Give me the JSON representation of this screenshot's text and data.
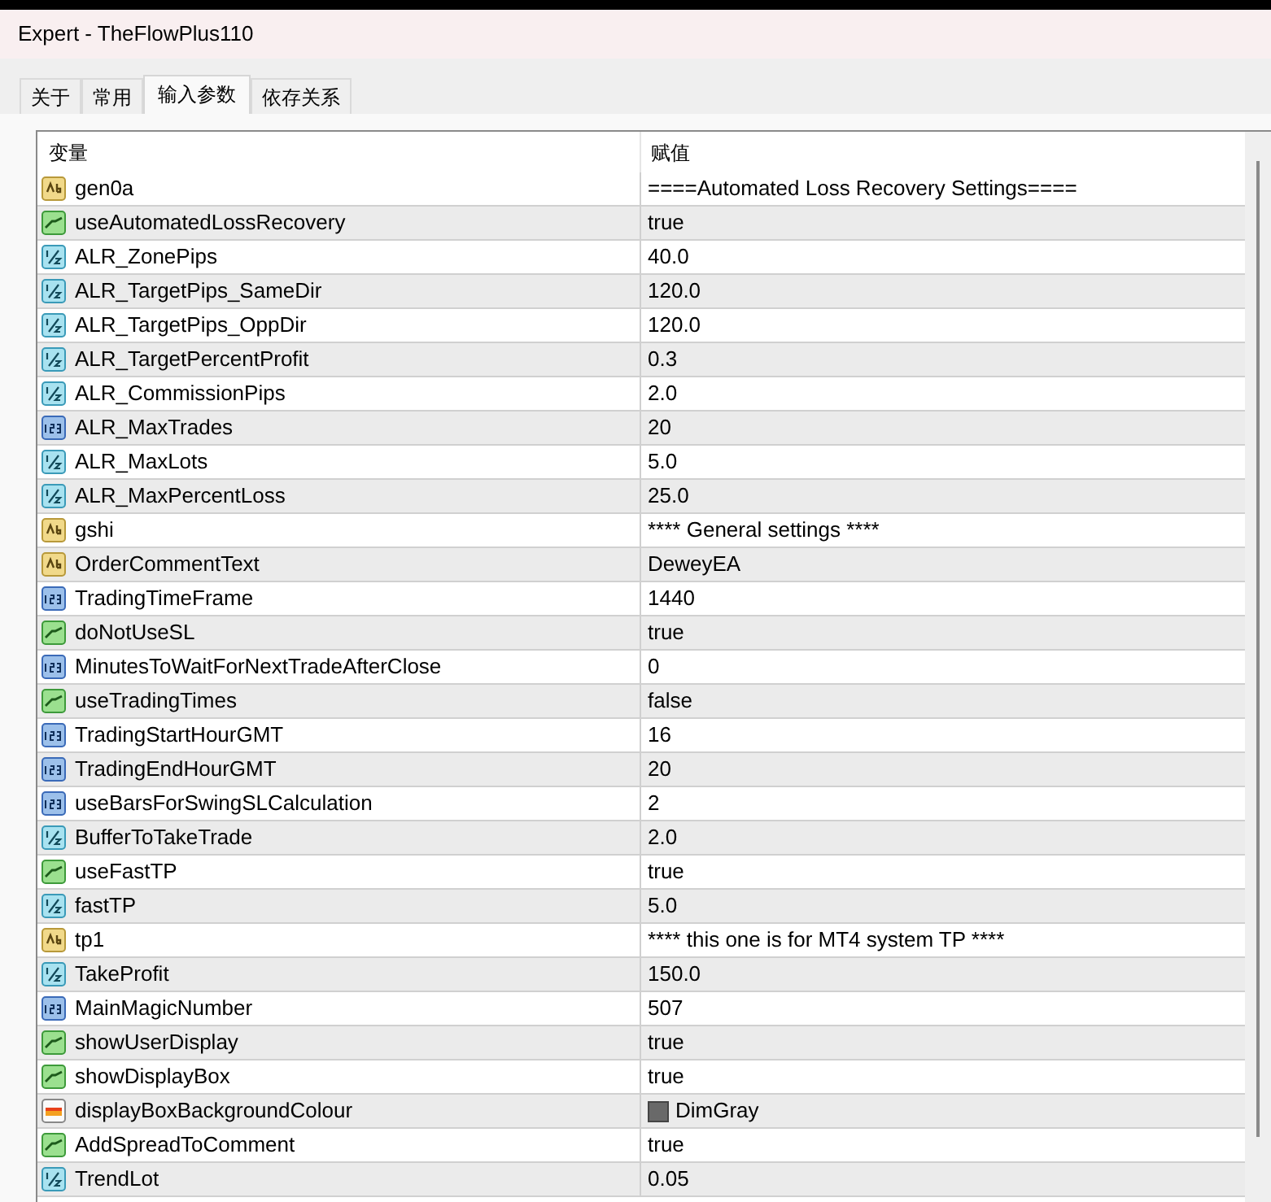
{
  "window": {
    "title": "Expert - TheFlowPlus110"
  },
  "tabs": [
    {
      "label": "关于",
      "selected": false
    },
    {
      "label": "常用",
      "selected": false
    },
    {
      "label": "输入参数",
      "selected": true
    },
    {
      "label": "依存关系",
      "selected": false
    }
  ],
  "table": {
    "columns": [
      "变量",
      "赋值"
    ],
    "rows": [
      {
        "kind": "string",
        "name": "gen0a",
        "value": "====Automated Loss Recovery Settings===="
      },
      {
        "kind": "bool",
        "name": "useAutomatedLossRecovery",
        "value": "true"
      },
      {
        "kind": "double",
        "name": "ALR_ZonePips",
        "value": "40.0"
      },
      {
        "kind": "double",
        "name": "ALR_TargetPips_SameDir",
        "value": "120.0"
      },
      {
        "kind": "double",
        "name": "ALR_TargetPips_OppDir",
        "value": "120.0"
      },
      {
        "kind": "double",
        "name": "ALR_TargetPercentProfit",
        "value": "0.3"
      },
      {
        "kind": "double",
        "name": "ALR_CommissionPips",
        "value": "2.0"
      },
      {
        "kind": "int",
        "name": "ALR_MaxTrades",
        "value": "20"
      },
      {
        "kind": "double",
        "name": "ALR_MaxLots",
        "value": "5.0"
      },
      {
        "kind": "double",
        "name": "ALR_MaxPercentLoss",
        "value": "25.0"
      },
      {
        "kind": "string",
        "name": "gshi",
        "value": "**** General settings ****"
      },
      {
        "kind": "string",
        "name": "OrderCommentText",
        "value": "DeweyEA"
      },
      {
        "kind": "int",
        "name": "TradingTimeFrame",
        "value": "1440"
      },
      {
        "kind": "bool",
        "name": "doNotUseSL",
        "value": "true"
      },
      {
        "kind": "int",
        "name": "MinutesToWaitForNextTradeAfterClose",
        "value": "0"
      },
      {
        "kind": "bool",
        "name": "useTradingTimes",
        "value": "false"
      },
      {
        "kind": "int",
        "name": "TradingStartHourGMT",
        "value": "16"
      },
      {
        "kind": "int",
        "name": "TradingEndHourGMT",
        "value": "20"
      },
      {
        "kind": "int",
        "name": "useBarsForSwingSLCalculation",
        "value": "2"
      },
      {
        "kind": "double",
        "name": "BufferToTakeTrade",
        "value": "2.0"
      },
      {
        "kind": "bool",
        "name": "useFastTP",
        "value": "true"
      },
      {
        "kind": "double",
        "name": "fastTP",
        "value": "5.0"
      },
      {
        "kind": "string",
        "name": "tp1",
        "value": "**** this one is for MT4 system TP ****"
      },
      {
        "kind": "double",
        "name": "TakeProfit",
        "value": "150.0"
      },
      {
        "kind": "int",
        "name": "MainMagicNumber",
        "value": "507"
      },
      {
        "kind": "bool",
        "name": "showUserDisplay",
        "value": "true"
      },
      {
        "kind": "bool",
        "name": "showDisplayBox",
        "value": "true"
      },
      {
        "kind": "color",
        "name": "displayBoxBackgroundColour",
        "value": "DimGray",
        "color": "#696969"
      },
      {
        "kind": "bool",
        "name": "AddSpreadToComment",
        "value": "true"
      },
      {
        "kind": "double",
        "name": "TrendLot",
        "value": "0.05"
      }
    ]
  }
}
